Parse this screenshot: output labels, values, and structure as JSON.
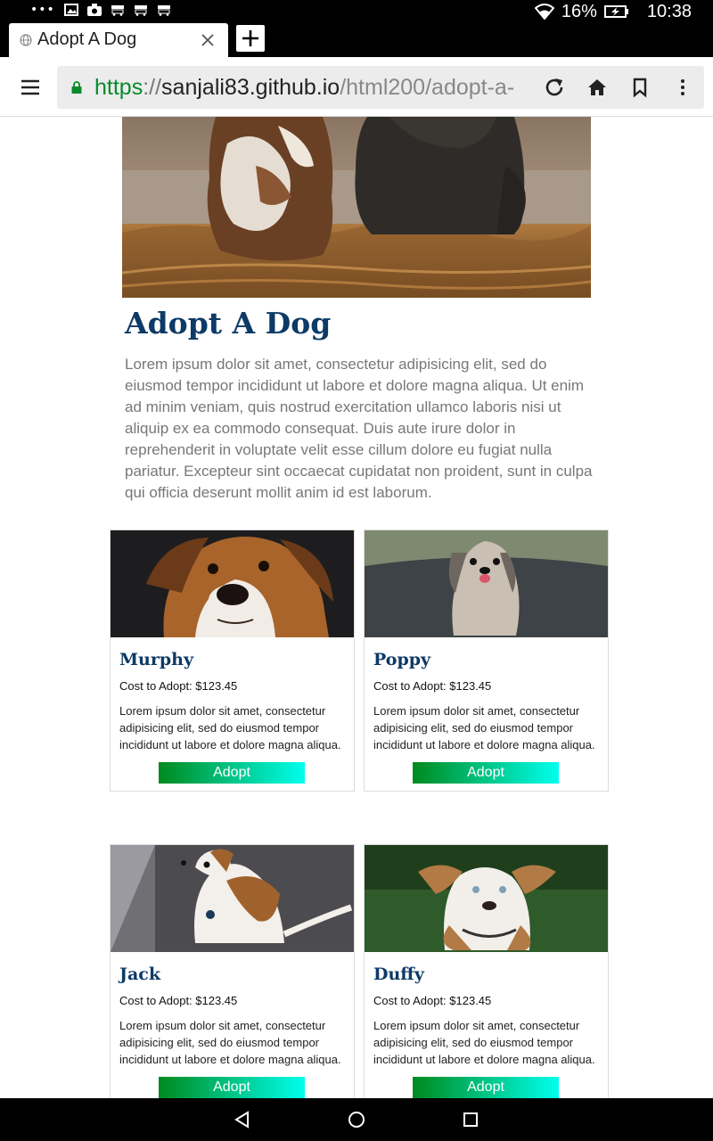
{
  "status_bar": {
    "battery": "16%",
    "time": "10:38"
  },
  "tab": {
    "title": "Adopt A Dog"
  },
  "address_bar": {
    "scheme": "https",
    "separator": "://",
    "host": "sanjali83.github.io",
    "path": "/html200/adopt-a-"
  },
  "page": {
    "title": "Adopt A Dog",
    "intro": "Lorem ipsum dolor sit amet, consectetur adipisicing elit, sed do eiusmod tempor incididunt ut labore et dolore magna aliqua. Ut enim ad minim veniam, quis nostrud exercitation ullamco laboris nisi ut aliquip ex ea commodo consequat. Duis aute irure dolor in reprehenderit in voluptate velit esse cillum dolore eu fugiat nulla pariatur. Excepteur sint occaecat cupidatat non proident, sunt in culpa qui officia deserunt mollit anim id est laborum."
  },
  "dogs": [
    {
      "name": "Murphy",
      "cost": "Cost to Adopt: $123.45",
      "desc": "Lorem ipsum dolor sit amet, consectetur adipisicing elit, sed do eiusmod tempor incididunt ut labore et dolore magna aliqua.",
      "button": "Adopt"
    },
    {
      "name": "Poppy",
      "cost": "Cost to Adopt: $123.45",
      "desc": "Lorem ipsum dolor sit amet, consectetur adipisicing elit, sed do eiusmod tempor incididunt ut labore et dolore magna aliqua.",
      "button": "Adopt"
    },
    {
      "name": "Jack",
      "cost": "Cost to Adopt: $123.45",
      "desc": "Lorem ipsum dolor sit amet, consectetur adipisicing elit, sed do eiusmod tempor incididunt ut labore et dolore magna aliqua.",
      "button": "Adopt"
    },
    {
      "name": "Duffy",
      "cost": "Cost to Adopt: $123.45",
      "desc": "Lorem ipsum dolor sit amet, consectetur adipisicing elit, sed do eiusmod tempor incididunt ut labore et dolore magna aliqua.",
      "button": "Adopt"
    }
  ],
  "colors": {
    "heading": "#0d3a66",
    "button_start": "#008a1e",
    "button_end": "#00ffee",
    "url_scheme": "#0a8a2b"
  },
  "icons": {
    "status": [
      "more-icon",
      "image-icon",
      "camera-icon",
      "wifi-icon",
      "battery-charging-icon"
    ],
    "toolbar": [
      "menu-icon",
      "lock-icon",
      "reload-icon",
      "home-icon",
      "bookmark-icon",
      "overflow-menu-icon"
    ],
    "nav": [
      "back-icon",
      "home-circle-icon",
      "recents-icon"
    ]
  }
}
